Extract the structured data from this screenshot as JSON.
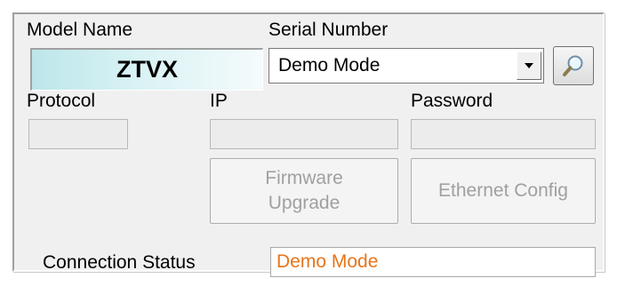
{
  "labels": {
    "model_name": "Model Name",
    "serial_number": "Serial Number",
    "protocol": "Protocol",
    "ip": "IP",
    "password": "Password",
    "connection_status": "Connection Status"
  },
  "model": {
    "value": "ZTVX"
  },
  "serial": {
    "selected": "Demo Mode"
  },
  "fields": {
    "protocol_value": "",
    "ip_value": "",
    "password_value": ""
  },
  "buttons": {
    "firmware_upgrade_line1": "Firmware",
    "firmware_upgrade_line2": "Upgrade",
    "ethernet_config": "Ethernet Config",
    "search_icon": "magnifier-icon"
  },
  "status": {
    "value": "Demo Mode",
    "color": "#e8751a"
  },
  "colors": {
    "panel_bg": "#f0f0f0",
    "model_gradient_start": "#bde6ea",
    "disabled_text": "#a0a0a0"
  }
}
